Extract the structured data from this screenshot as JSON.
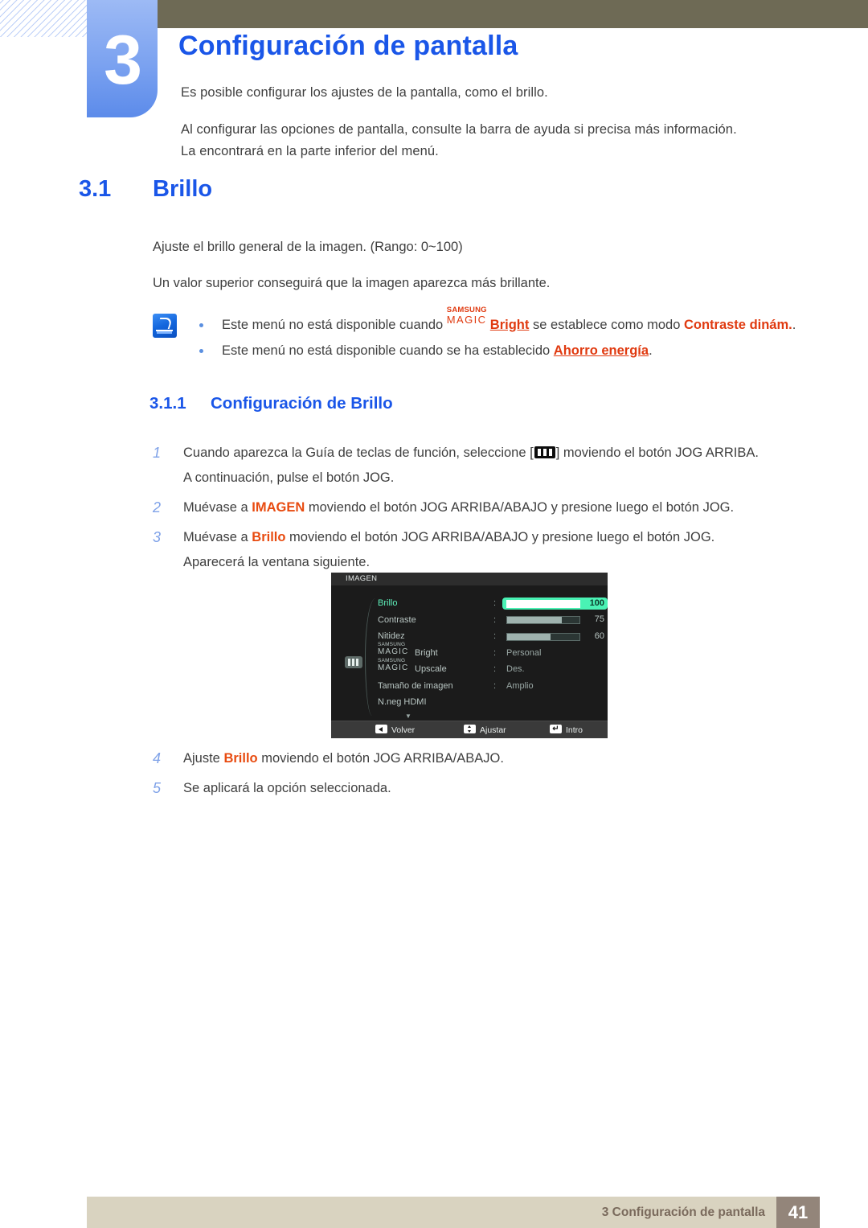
{
  "chapter": {
    "number": "3",
    "title": "Configuración de pantalla",
    "intro_lines": [
      "Es posible configurar los ajustes de la pantalla, como el brillo.",
      "Al configurar las opciones de pantalla, consulte la barra de ayuda si precisa más información.",
      "La encontrará en la parte inferior del menú."
    ]
  },
  "section": {
    "number": "3.1",
    "title": "Brillo",
    "paragraphs": [
      "Ajuste el brillo general de la imagen. (Rango: 0~100)",
      "Un valor superior conseguirá que la imagen aparezca más brillante."
    ]
  },
  "note": {
    "icon": "note-pencil-icon",
    "items": [
      {
        "before": "Este menú no está disponible cuando ",
        "magic_top": "SAMSUNG",
        "magic_bottom": "MAGIC",
        "magic_word": "Bright",
        "middle": " se establece como modo ",
        "highlight": "Contraste dinám.",
        "after": "."
      },
      {
        "before": "Este menú no está disponible cuando se ha establecido ",
        "highlight": "Ahorro energía",
        "after": "."
      }
    ]
  },
  "subsection": {
    "number": "3.1.1",
    "title": "Configuración de Brillo"
  },
  "steps": [
    {
      "num": "1",
      "text_a": "Cuando aparezca la Guía de teclas de función, seleccione [",
      "icon": "menu-bars-icon",
      "text_b": "] moviendo el botón JOG ARRIBA.",
      "sub": "A continuación, pulse el botón JOG."
    },
    {
      "num": "2",
      "text_a": "Muévase a ",
      "highlight": "IMAGEN",
      "text_b": " moviendo el botón JOG ARRIBA/ABAJO y presione luego el botón JOG.",
      "sub": ""
    },
    {
      "num": "3",
      "text_a": "Muévase a ",
      "highlight": "Brillo",
      "text_b": " moviendo el botón JOG ARRIBA/ABAJO y presione luego el botón JOG.",
      "sub": "Aparecerá la ventana siguiente."
    },
    {
      "num": "4",
      "text_a": "Ajuste ",
      "highlight": "Brillo",
      "text_b": " moviendo el botón JOG ARRIBA/ABAJO.",
      "sub": ""
    },
    {
      "num": "5",
      "text_a": "Se aplicará la opción seleccionada.",
      "highlight": "",
      "text_b": "",
      "sub": ""
    }
  ],
  "osd": {
    "title": "IMAGEN",
    "side_icon": "picture-menu-icon",
    "scroll_down_icon": "chevron-down-icon",
    "accent_color": "#4af2b4",
    "rows": [
      {
        "label": "Brillo",
        "type": "slider",
        "value": "100",
        "fill_pct": 100,
        "selected": true
      },
      {
        "label": "Contraste",
        "type": "slider",
        "value": "75",
        "fill_pct": 75,
        "selected": false
      },
      {
        "label": "Nitidez",
        "type": "slider",
        "value": "60",
        "fill_pct": 60,
        "selected": false
      },
      {
        "label": "Bright",
        "type": "magic",
        "value": "Personal",
        "selected": false,
        "magic_top": "SAMSUNG",
        "magic_bottom": "MAGIC"
      },
      {
        "label": "Upscale",
        "type": "magic",
        "value": "Des.",
        "selected": false,
        "magic_top": "SAMSUNG",
        "magic_bottom": "MAGIC"
      },
      {
        "label": "Tamaño de imagen",
        "type": "text",
        "value": "Amplio",
        "selected": false
      },
      {
        "label": "N.neg HDMI",
        "type": "text",
        "value": "",
        "selected": false
      }
    ],
    "footer": [
      {
        "icon": "arrow-left-icon",
        "label": "Volver"
      },
      {
        "icon": "arrow-up-down-icon",
        "label": "Ajustar"
      },
      {
        "icon": "enter-arrow-icon",
        "label": "Intro"
      }
    ]
  },
  "page_footer": {
    "text": "3 Configuración de pantalla",
    "page_number": "41"
  }
}
